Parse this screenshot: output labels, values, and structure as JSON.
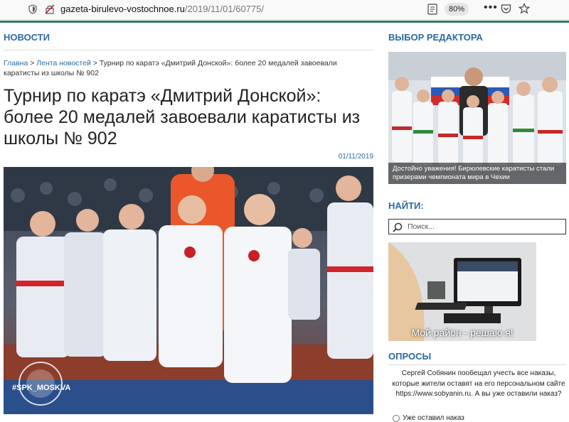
{
  "browser": {
    "url_domain": "gazeta-birulevo-vostochnoe.ru",
    "url_path": "/2019/11/01/60775/",
    "zoom": "80%",
    "more_label": "•••"
  },
  "main": {
    "section_title": "НОВОСТИ",
    "breadcrumbs": {
      "home": "Главна",
      "sep1": " > ",
      "feed": "Лента новостей",
      "sep2": " > ",
      "current": "Турнир по каратэ «Дмитрий Донской»: более 20 медалей завоевали каратисты из школы № 902"
    },
    "article_title": "Турнир по каратэ «Дмитрий Донской»: более 20 медалей завоевали каратисты из школы № 902",
    "date": "01/11/2019",
    "photo_watermark": "#SPK_MOSKVA"
  },
  "sidebar": {
    "editor_title": "ВЫБОР РЕДАКТОРА",
    "editor_caption": "Достойно уважения! Бирюлевские каратисты стали призерами чемпионата мира в Чехии",
    "search_title": "НАЙТИ:",
    "search_placeholder": "Поиск...",
    "banner_text": "Мой район - решаю я!",
    "polls_title": "ОПРОСЫ",
    "poll_question": "Сергей Собянин пообещал учесть все наказы, которые жители оставят на его персональном сайте https://www.sobyanin.ru. А вы уже оставили наказ?",
    "poll_option_1": "Уже оставил наказ"
  },
  "colors": {
    "accent": "#2a6aa5",
    "browser_green": "#2e7d5b"
  }
}
